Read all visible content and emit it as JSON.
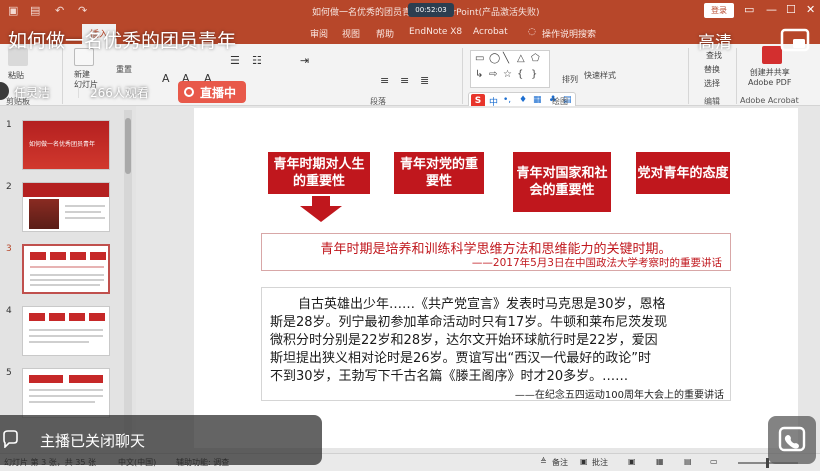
{
  "window": {
    "title": "如何做一名优秀的团员青年 - PowerPoint(产品激活失败)",
    "timer": "00:52:03",
    "login": "登录"
  },
  "ribbon_tabs": [
    "插入",
    "审阅",
    "视图",
    "帮助",
    "EndNote X8",
    "Acrobat",
    "操作说明搜索"
  ],
  "ribbon": {
    "paste": "粘贴",
    "new_slide": "新建\n幻灯片",
    "reset": "重置",
    "clipboard_group": "剪贴板",
    "paragraph_group": "段落",
    "drawing_group": "绘图",
    "editing_group": "编辑",
    "acrobat_group": "Adobe Acrobat",
    "arrange": "排列",
    "quick_styles": "快速样式",
    "find": "查找",
    "replace": "替换",
    "select": "选择",
    "create_share_pdf": "创建并共享\nAdobe PDF",
    "ime_s": "S"
  },
  "thumbnails": [
    {
      "num": "1",
      "caption": "如何做一名优秀团员青年"
    },
    {
      "num": "2",
      "caption": ""
    },
    {
      "num": "3",
      "caption": ""
    },
    {
      "num": "4",
      "caption": ""
    },
    {
      "num": "5",
      "caption": ""
    }
  ],
  "slide": {
    "buttons": [
      "青年时期对人生的重要性",
      "青年对党的重要性",
      "青年对国家和社会的重要性",
      "党对青年的态度"
    ],
    "quote1_main": "青年时期是培养和训练科学思维方法和思维能力的关键时期。",
    "quote1_source": "——2017年5月3日在中国政法大学考察时的重要讲话",
    "quote2_lines": [
      "自古英雄出少年……《共产党宣言》发表时马克思是30岁，恩格",
      "斯是28岁。列宁最初参加革命活动时只有17岁。牛顿和莱布尼茨发现",
      "微积分时分别是22岁和28岁，达尔文开始环球航行时是22岁，爱因",
      "斯坦提出狭义相对论时是26岁。贾谊写出“西汉一代最好的政论”时",
      "不到30岁，王勃写下千古名篇《滕王阁序》时才20多岁。……"
    ],
    "quote2_source": "——在纪念五四运动100周年大会上的重要讲话"
  },
  "status": {
    "slide_info": "幻灯片 第 3 张，共 35 张",
    "language": "中文(中国)",
    "accessibility": "辅助功能: 调查",
    "notes": "备注",
    "comments": "批注"
  },
  "overlay": {
    "title": "如何做一名优秀的团员青年",
    "quality": "高清",
    "host": "任灵洁",
    "viewers": "266人观看",
    "live": "直播中",
    "chat_closed": "主播已关闭聊天"
  },
  "colors": {
    "ppt_accent": "#b7472a",
    "slide_red": "#c0171d",
    "live_badge": "#e74c3c"
  }
}
